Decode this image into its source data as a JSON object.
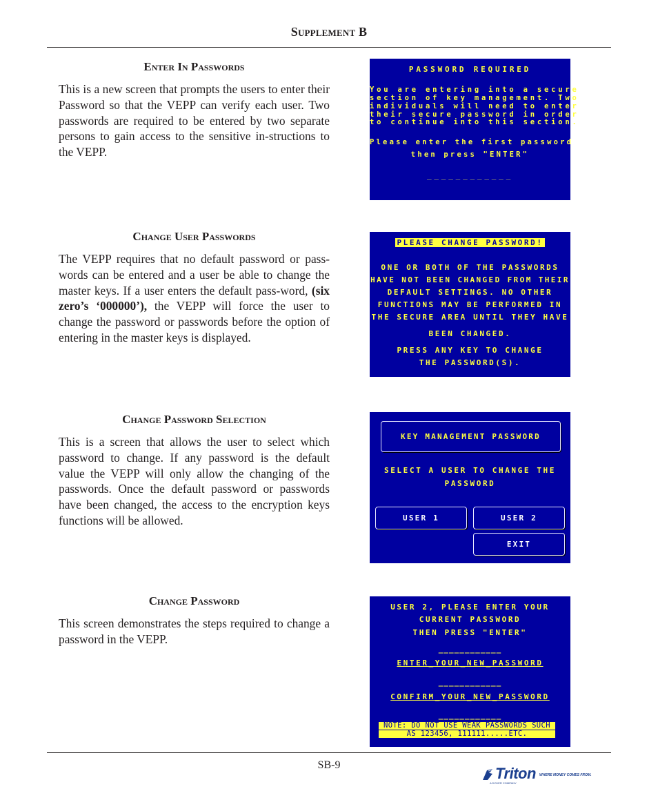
{
  "header": {
    "title": "Supplement B"
  },
  "sections": [
    {
      "heading": "Enter In Passwords",
      "body": "This is a new screen that prompts the users to enter their Password so that the VEPP can verify each user. Two passwords are required to be entered by two separate persons to gain access to the sensitive in-structions to the VEPP."
    },
    {
      "heading": "Change User Passwords",
      "body_before": "The VEPP requires that no default password or pass-words can be entered and a user be able to change the master keys.  If a user enters the default pass-word, ",
      "body_bold": "(six zero’s ‘000000’),",
      "body_after": " the VEPP will force the user to change the password or passwords before the option of entering in the master keys is displayed."
    },
    {
      "heading": "Change Password Selection",
      "body": "This is a screen that allows the user to select which password to change.  If any password is the default value the VEPP will only allow the changing of the passwords.  Once the default password or passwords have been changed, the access to the encryption keys functions will be allowed."
    },
    {
      "heading": "Change Password",
      "body": "This screen demonstrates the steps required to change a password in the VEPP."
    }
  ],
  "screens": {
    "password_required": {
      "title": "PASSWORD REQUIRED",
      "lines": [
        "You are entering into a secure",
        "section of key management. Two",
        "individuals will need to enter",
        "their secure password in order",
        "to continue into this section."
      ],
      "prompt1": "Please enter the first password",
      "prompt2": "then press \"ENTER\"",
      "input_mask": "____________"
    },
    "please_change": {
      "banner": "PLEASE CHANGE PASSWORD!",
      "lines": [
        "ONE OR BOTH OF THE PASSWORDS",
        "HAVE NOT BEEN CHANGED FROM THEIR",
        "DEFAULT SETTINGS. NO OTHER",
        "FUNCTIONS MAY BE PERFORMED IN",
        "THE SECURE AREA UNTIL THEY HAVE",
        "BEEN CHANGED."
      ],
      "press1": "PRESS ANY KEY TO CHANGE",
      "press2": "THE PASSWORD(S)."
    },
    "selection": {
      "title": "KEY MANAGEMENT PASSWORD",
      "prompt1": "SELECT A USER TO CHANGE THE",
      "prompt2": "PASSWORD",
      "buttons": {
        "user1": "USER 1",
        "user2": "USER 2",
        "exit": "EXIT"
      }
    },
    "change_password": {
      "line1": "USER 2, PLEASE ENTER YOUR",
      "line2": "CURRENT PASSWORD",
      "line3": "THEN PRESS \"ENTER\"",
      "mask": "____________",
      "new_label": "ENTER_YOUR_NEW_PASSWORD",
      "confirm_label": "CONFIRM_YOUR_NEW_PASSWORD",
      "note1": "NOTE: DO NOT USE WEAK PASSWORDS SUCH",
      "note2": "AS 123456, 111111.....ETC."
    }
  },
  "footer": {
    "page_number": "SB-9",
    "logo_name": "Triton",
    "logo_tagline": "WHERE MONEY COMES FROM.",
    "logo_sub": "A DOVER COMPANY"
  },
  "colors": {
    "screen_bg": "#0000a0",
    "screen_text": "#ffff40",
    "logo_blue": "#1b3f8f"
  }
}
